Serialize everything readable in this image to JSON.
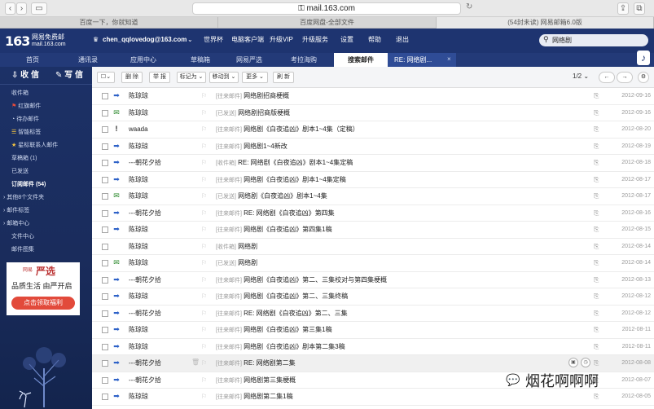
{
  "browser": {
    "url": "mail.163.com",
    "tabs": [
      "百度一下，你就知道",
      "百度网盘-全部文件",
      "(54封未读) 网易邮箱6.0版"
    ]
  },
  "header": {
    "logo": "163",
    "logo_line1": "网易免费邮",
    "logo_line2": "mail.163.com",
    "user": "chen_qqlovedog@163.com",
    "links": [
      "世界杯",
      "电脑客户端",
      "升级VIP",
      "升级服务",
      "设置",
      "帮助",
      "退出"
    ],
    "search_value": "网络剧"
  },
  "nav": {
    "tabs": [
      "首页",
      "通讯录",
      "应用中心",
      "草稿箱",
      "网易严选",
      "考拉海购",
      "搜索邮件",
      "RE: 网络剧..."
    ]
  },
  "sidebar": {
    "receive": "收 信",
    "write": "写 信",
    "items": [
      "收件箱",
      "红旗邮件",
      "待办邮件",
      "智能标签",
      "星标联系人邮件",
      "草稿箱 (1)",
      "已发送",
      "订阅邮件 (54)",
      "其他8个文件夹",
      "邮件标签",
      "邮箱中心",
      "文件中心",
      "邮件图集"
    ],
    "ad": {
      "brand_small": "网易",
      "brand": "严选",
      "slogan": "品质生活 由严开启",
      "cta": "点击领取福利"
    }
  },
  "toolbar": {
    "buttons": [
      "删 除",
      "举 报",
      "标记为",
      "移动到",
      "更多",
      "刷 新"
    ],
    "page": "1/2"
  },
  "emails": [
    {
      "from": "陈琼琼",
      "tag": "[往来邮件]",
      "subject": "网络剧招商梗概",
      "date": "2012-09-16",
      "icon": "in"
    },
    {
      "from": "陈琼琼",
      "tag": "[已发送]",
      "subject": "网络剧招商版梗概",
      "date": "2012-09-16",
      "icon": "sent"
    },
    {
      "from": "waada",
      "tag": "[往来邮件]",
      "subject": "网络剧《白夜追凶》剧本1~4集（定稿）",
      "date": "2012-08-20",
      "icon": "bang"
    },
    {
      "from": "陈琼琼",
      "tag": "[往来邮件]",
      "subject": "网络剧1~4新改",
      "date": "2012-08-19",
      "icon": "in"
    },
    {
      "from": "---朝花夕拾",
      "tag": "[收件箱]",
      "subject": "RE: 网络剧《白夜追凶》剧本1~4集定稿",
      "date": "2012-08-18",
      "icon": "in"
    },
    {
      "from": "陈琼琼",
      "tag": "[往来邮件]",
      "subject": "网络剧《白夜追凶》剧本1~4集定稿",
      "date": "2012-08-17",
      "icon": "in"
    },
    {
      "from": "陈琼琼",
      "tag": "[已发送]",
      "subject": "网络剧《白夜追凶》剧本1~4集",
      "date": "2012-08-17",
      "icon": "sent"
    },
    {
      "from": "---朝花夕拾",
      "tag": "[往来邮件]",
      "subject": "RE: 网络剧《白夜追凶》第四集",
      "date": "2012-08-16",
      "icon": "in"
    },
    {
      "from": "陈琼琼",
      "tag": "[往来邮件]",
      "subject": "网络剧《白夜追凶》第四集1稿",
      "date": "2012-08-15",
      "icon": "in"
    },
    {
      "from": "陈琼琼",
      "tag": "[收件箱]",
      "subject": "网络剧",
      "date": "2012-08-14",
      "icon": "none"
    },
    {
      "from": "陈琼琼",
      "tag": "[已发送]",
      "subject": "网络剧",
      "date": "2012-08-14",
      "icon": "sent"
    },
    {
      "from": "---朝花夕拾",
      "tag": "[往来邮件]",
      "subject": "网络剧《白夜追凶》第二、三集校对与第四集梗概",
      "date": "2012-08-13",
      "icon": "in"
    },
    {
      "from": "陈琼琼",
      "tag": "[往来邮件]",
      "subject": "网络剧《白夜追凶》第二、三集终稿",
      "date": "2012-08-12",
      "icon": "in"
    },
    {
      "from": "---朝花夕拾",
      "tag": "[往来邮件]",
      "subject": "RE: 网络剧《白夜追凶》第二、三集",
      "date": "2012-08-12",
      "icon": "in"
    },
    {
      "from": "陈琼琼",
      "tag": "[往来邮件]",
      "subject": "网络剧《白夜追凶》第三集1稿",
      "date": "2012-08-11",
      "icon": "in"
    },
    {
      "from": "陈琼琼",
      "tag": "[往来邮件]",
      "subject": "网络剧《白夜追凶》剧本第二集3稿",
      "date": "2012-08-11",
      "icon": "in"
    },
    {
      "from": "---朝花夕拾",
      "tag": "[往来邮件]",
      "subject": "RE: 网络剧第二集",
      "date": "2012-08-08",
      "icon": "in"
    },
    {
      "from": "---朝花夕拾",
      "tag": "[往来邮件]",
      "subject": "网络剧第三集梗概",
      "date": "2012-08-07",
      "icon": "in"
    },
    {
      "from": "陈琼琼",
      "tag": "[往来邮件]",
      "subject": "网络剧第二集1稿",
      "date": "2012-08-05",
      "icon": "in"
    }
  ],
  "watermark": "烟花啊啊啊",
  "colors": {
    "header_bg": "#1e3470",
    "sidebar_bg": "#1a2c5c",
    "accent": "#2e62c8",
    "ad_red": "#e24a3b"
  }
}
